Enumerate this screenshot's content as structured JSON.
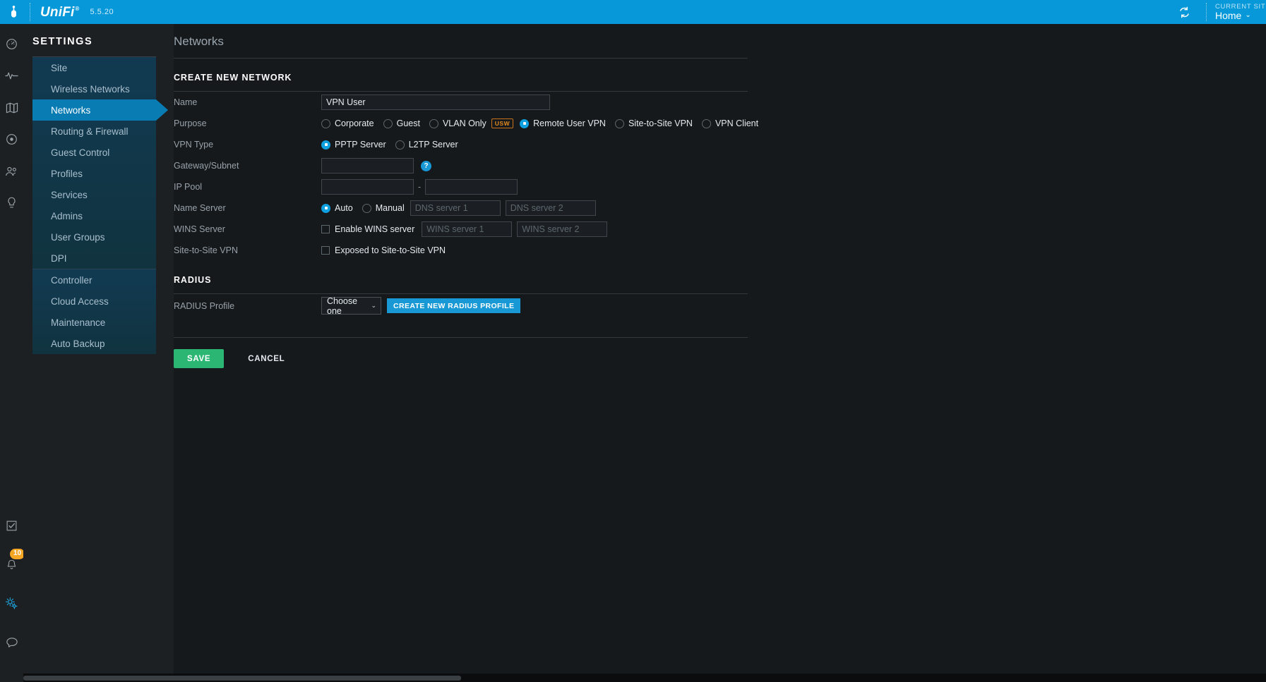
{
  "topbar": {
    "logo_icon": "ubiquiti-u-logo",
    "brand": "UniFi",
    "version": "5.5.20",
    "refresh_icon": "refresh-icon",
    "current_site_label": "CURRENT SITE",
    "current_site_name": "Home",
    "caret": "⌄"
  },
  "rail": {
    "top_icons": [
      {
        "name": "dashboard-icon"
      },
      {
        "name": "statistics-icon"
      },
      {
        "name": "map-icon"
      },
      {
        "name": "devices-icon"
      },
      {
        "name": "clients-icon"
      },
      {
        "name": "insights-icon"
      }
    ],
    "bottom_icons": [
      {
        "name": "events-icon",
        "badge": ""
      },
      {
        "name": "alerts-bell-icon",
        "badge": "10"
      },
      {
        "name": "settings-gears-icon",
        "badge": "",
        "active": true
      },
      {
        "name": "chat-icon",
        "badge": ""
      }
    ]
  },
  "sidebar": {
    "title": "SETTINGS",
    "group1": [
      {
        "label": "Site",
        "selected": false
      },
      {
        "label": "Wireless Networks",
        "selected": false
      },
      {
        "label": "Networks",
        "selected": true
      },
      {
        "label": "Routing & Firewall",
        "selected": false
      },
      {
        "label": "Guest Control",
        "selected": false
      },
      {
        "label": "Profiles",
        "selected": false
      },
      {
        "label": "Services",
        "selected": false
      },
      {
        "label": "Admins",
        "selected": false
      },
      {
        "label": "User Groups",
        "selected": false
      },
      {
        "label": "DPI",
        "selected": false
      }
    ],
    "group2": [
      {
        "label": "Controller",
        "selected": false
      },
      {
        "label": "Cloud Access",
        "selected": false
      },
      {
        "label": "Maintenance",
        "selected": false
      },
      {
        "label": "Auto Backup",
        "selected": false
      }
    ]
  },
  "main": {
    "page_title": "Networks",
    "section_create": "CREATE NEW NETWORK",
    "section_radius": "RADIUS",
    "labels": {
      "name": "Name",
      "purpose": "Purpose",
      "vpn_type": "VPN Type",
      "gateway_subnet": "Gateway/Subnet",
      "ip_pool": "IP Pool",
      "name_server": "Name Server",
      "wins_server": "WINS Server",
      "site_to_site_vpn": "Site-to-Site VPN",
      "radius_profile": "RADIUS Profile"
    },
    "name_value": "VPN User",
    "purpose_options": [
      {
        "label": "Corporate",
        "selected": false,
        "badge": ""
      },
      {
        "label": "Guest",
        "selected": false,
        "badge": ""
      },
      {
        "label": "VLAN Only",
        "selected": false,
        "badge": "USW"
      },
      {
        "label": "Remote User VPN",
        "selected": true,
        "badge": ""
      },
      {
        "label": "Site-to-Site VPN",
        "selected": false,
        "badge": ""
      },
      {
        "label": "VPN Client",
        "selected": false,
        "badge": ""
      }
    ],
    "vpn_type_options": [
      {
        "label": "PPTP Server",
        "selected": true
      },
      {
        "label": "L2TP Server",
        "selected": false
      }
    ],
    "gateway_subnet_value": "",
    "gateway_help_icon": "help-icon",
    "gateway_help_glyph": "?",
    "ip_pool_start": "",
    "ip_pool_end": "",
    "ip_pool_separator": "-",
    "name_server_options": [
      {
        "label": "Auto",
        "selected": true
      },
      {
        "label": "Manual",
        "selected": false
      }
    ],
    "dns1_placeholder": "DNS server 1",
    "dns2_placeholder": "DNS server 2",
    "dns1_value": "",
    "dns2_value": "",
    "wins_enable_label": "Enable WINS server",
    "wins_enabled": false,
    "wins1_placeholder": "WINS server 1",
    "wins2_placeholder": "WINS server 2",
    "wins1_value": "",
    "wins2_value": "",
    "site_to_site_checkbox_label": "Exposed to Site-to-Site VPN",
    "site_to_site_checked": false,
    "radius_profile_value": "Choose one",
    "radius_caret": "⌄",
    "radius_create_button": "CREATE NEW RADIUS PROFILE",
    "save_button": "SAVE",
    "cancel_button": "CANCEL"
  },
  "colors": {
    "brand_blue": "#0698d9",
    "accent_blue": "#1899d6",
    "selected_nav": "#0a7cb4",
    "save_green": "#2bb673",
    "badge_orange": "#f5a623",
    "usw_orange": "#e2891f",
    "panel_dark": "#1c2023",
    "main_bg": "#16191c"
  }
}
